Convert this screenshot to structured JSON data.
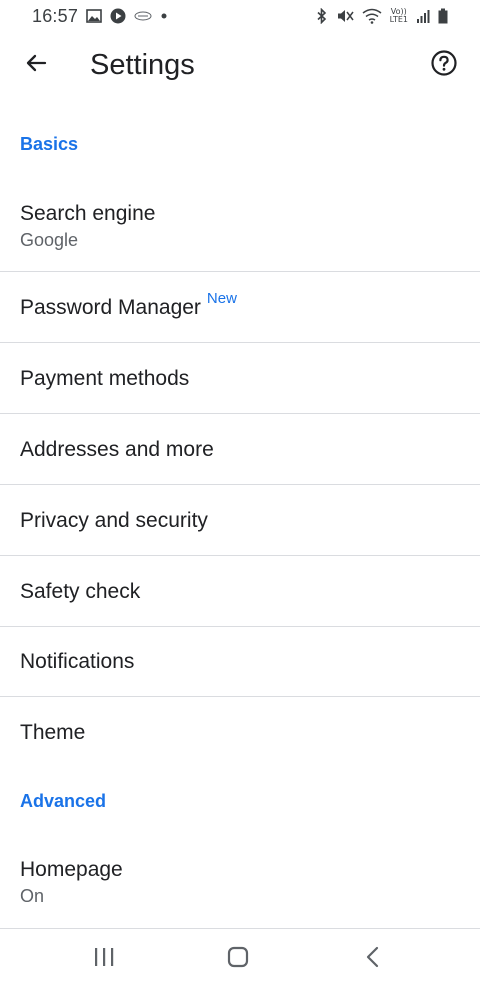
{
  "status_bar": {
    "time": "16:57",
    "network_label_top": "Vo))",
    "network_label_bottom": "LTE1",
    "icons": [
      "image-icon",
      "play-icon",
      "app-icon",
      "dot-icon",
      "bluetooth-icon",
      "mute-icon",
      "wifi-icon",
      "signal-icon",
      "battery-icon"
    ]
  },
  "app_bar": {
    "title": "Settings",
    "back_icon": "arrow-back-icon",
    "help_icon": "help-icon"
  },
  "sections": {
    "basics": {
      "header": "Basics",
      "items": [
        {
          "title": "Search engine",
          "subtitle": "Google"
        },
        {
          "title": "Password Manager",
          "badge": "New"
        },
        {
          "title": "Payment methods"
        },
        {
          "title": "Addresses and more"
        },
        {
          "title": "Privacy and security"
        },
        {
          "title": "Safety check"
        },
        {
          "title": "Notifications"
        },
        {
          "title": "Theme"
        }
      ]
    },
    "advanced": {
      "header": "Advanced",
      "items": [
        {
          "title": "Homepage",
          "subtitle": "On"
        }
      ]
    }
  },
  "colors": {
    "accent": "#1a73e8",
    "text_primary": "#202124",
    "text_secondary": "#5f6368",
    "divider": "#dadce0"
  },
  "nav_bar": {
    "icons": [
      "recents-icon",
      "home-icon",
      "back-icon"
    ]
  }
}
